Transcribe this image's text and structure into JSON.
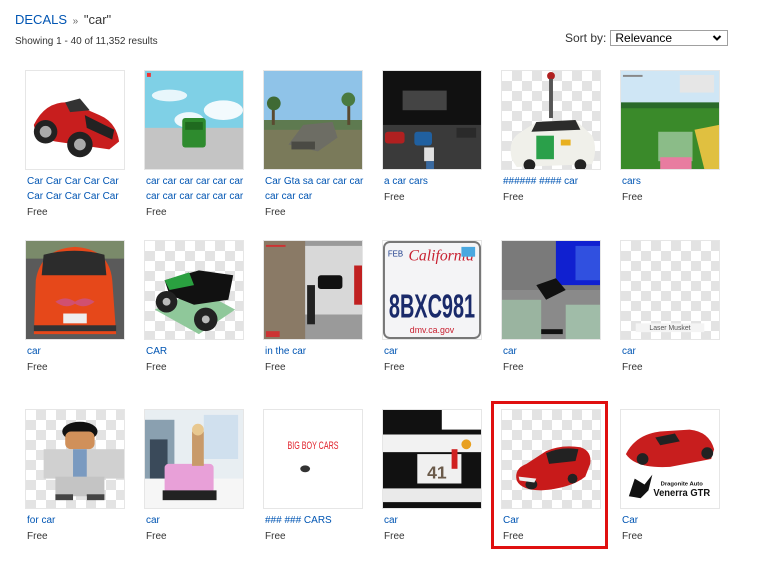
{
  "breadcrumb": {
    "category": "DECALS",
    "separator": "»",
    "query": "\"car\""
  },
  "results_summary": "Showing 1 - 40 of 11,352 results",
  "sort": {
    "label": "Sort by:",
    "selected": "Relevance",
    "icon": "chevron-down-icon"
  },
  "items": [
    {
      "name": "Car Car Car Car Car Car Car Car Car Car",
      "price": "Free",
      "thumb": "red-sports-car"
    },
    {
      "name": "car car car car car car car car car car car car",
      "price": "Free",
      "thumb": "green-car-sky"
    },
    {
      "name": "Car Gta sa car car car car car car",
      "price": "Free",
      "thumb": "gta-car"
    },
    {
      "name": "a car cars",
      "price": "Free",
      "thumb": "dark-game-scene"
    },
    {
      "name": "###### #### car",
      "price": "Free",
      "thumb": "street-view-car"
    },
    {
      "name": "cars",
      "price": "Free",
      "thumb": "game-ui-scene"
    },
    {
      "name": "car",
      "price": "Free",
      "thumb": "orange-car-mustache"
    },
    {
      "name": "CAR",
      "price": "Free",
      "thumb": "green-monster-truck"
    },
    {
      "name": "in the car",
      "price": "Free",
      "thumb": "garage-scene"
    },
    {
      "name": "car",
      "price": "Free",
      "thumb": "license-plate",
      "plate_text": "8BXC981",
      "plate_state": "California",
      "plate_month": "FEB",
      "plate_site": "dmv.ca.gov"
    },
    {
      "name": "car",
      "price": "Free",
      "thumb": "blocky-game-scene"
    },
    {
      "name": "car",
      "price": "Free",
      "thumb": "laser-musket",
      "caption": "Laser Musket"
    },
    {
      "name": "for car",
      "price": "Free",
      "thumb": "avatar-hat"
    },
    {
      "name": "car",
      "price": "Free",
      "thumb": "pink-jeep"
    },
    {
      "name": "### ### CARS",
      "price": "Free",
      "thumb": "big-boy-cars",
      "caption": "BIG BOY CARS"
    },
    {
      "name": "car",
      "price": "Free",
      "thumb": "race-car-livery",
      "caption": "41"
    },
    {
      "name": "Car",
      "price": "Free",
      "thumb": "red-sedan",
      "highlighted": true
    },
    {
      "name": "Car",
      "price": "Free",
      "thumb": "venerra-gtr",
      "caption_top": "Dragonite Auto",
      "caption_bottom": "Venerra GTR"
    }
  ],
  "colors": {
    "link": "#0055b3",
    "text": "#343434",
    "highlight": "#e01010"
  }
}
